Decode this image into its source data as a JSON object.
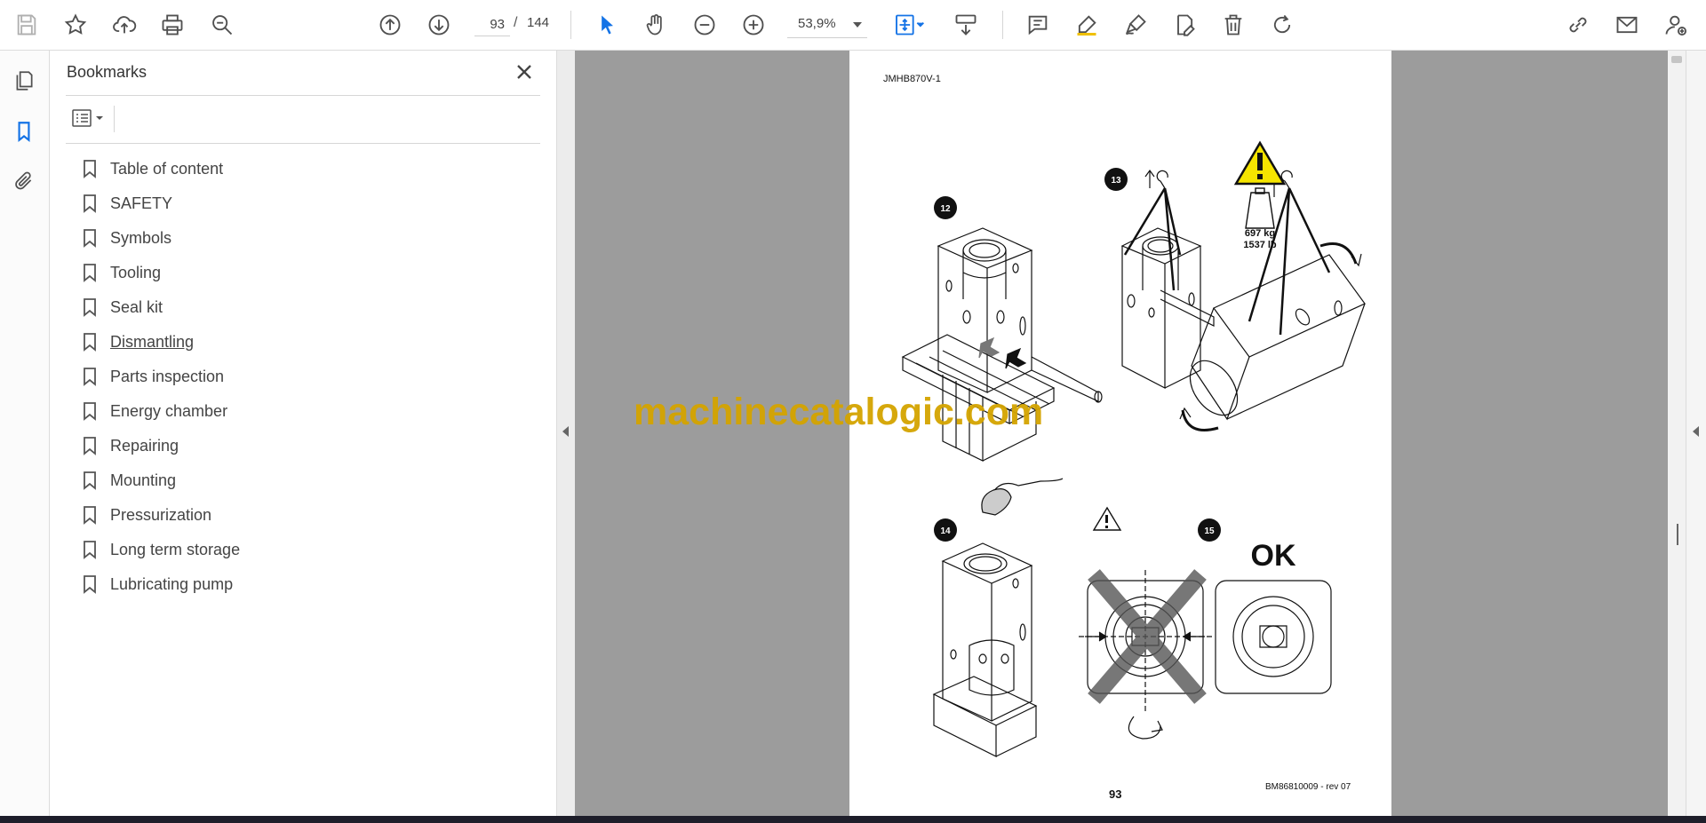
{
  "toolbar": {
    "page_current": "93",
    "page_separator": "/",
    "page_total": "144",
    "zoom": "53,9%",
    "icons": [
      "save-icon",
      "bookmark-star-icon",
      "upload-icon",
      "print-icon",
      "search-zoom-icon",
      "previous-page-icon",
      "next-page-icon",
      "select-tool-icon",
      "hand-tool-icon",
      "zoom-out-icon",
      "zoom-in-icon",
      "fit-page-icon",
      "scroll-mode-icon",
      "comment-icon",
      "highlight-icon",
      "sign-icon",
      "edit-pdf-icon",
      "delete-icon",
      "rotate-icon",
      "share-link-icon",
      "email-icon",
      "account-icon"
    ]
  },
  "bookmarks": {
    "title": "Bookmarks",
    "items": [
      {
        "label": "Table of content"
      },
      {
        "label": "SAFETY"
      },
      {
        "label": "Symbols"
      },
      {
        "label": "Tooling"
      },
      {
        "label": "Seal kit"
      },
      {
        "label": "Dismantling"
      },
      {
        "label": "Parts inspection"
      },
      {
        "label": "Energy chamber"
      },
      {
        "label": "Repairing"
      },
      {
        "label": "Mounting"
      },
      {
        "label": "Pressurization"
      },
      {
        "label": "Long term storage"
      },
      {
        "label": "Lubricating pump"
      }
    ],
    "active_index": 5
  },
  "document": {
    "header_code": "JMHB870V-1",
    "footer_code": "BM86810009 - rev 07",
    "page_number": "93",
    "watermark": "machinecatalogic.com",
    "steps": [
      "12",
      "13",
      "14",
      "15"
    ],
    "weight_kg": "697 kg",
    "weight_lb": "1537 lb",
    "ok_label": "OK"
  },
  "colors": {
    "accent_blue": "#1473e6",
    "icon_gray": "#505050",
    "doc_background": "#9c9c9c",
    "warning_yellow": "#f5e400",
    "watermark_gold": "#d4a400"
  }
}
